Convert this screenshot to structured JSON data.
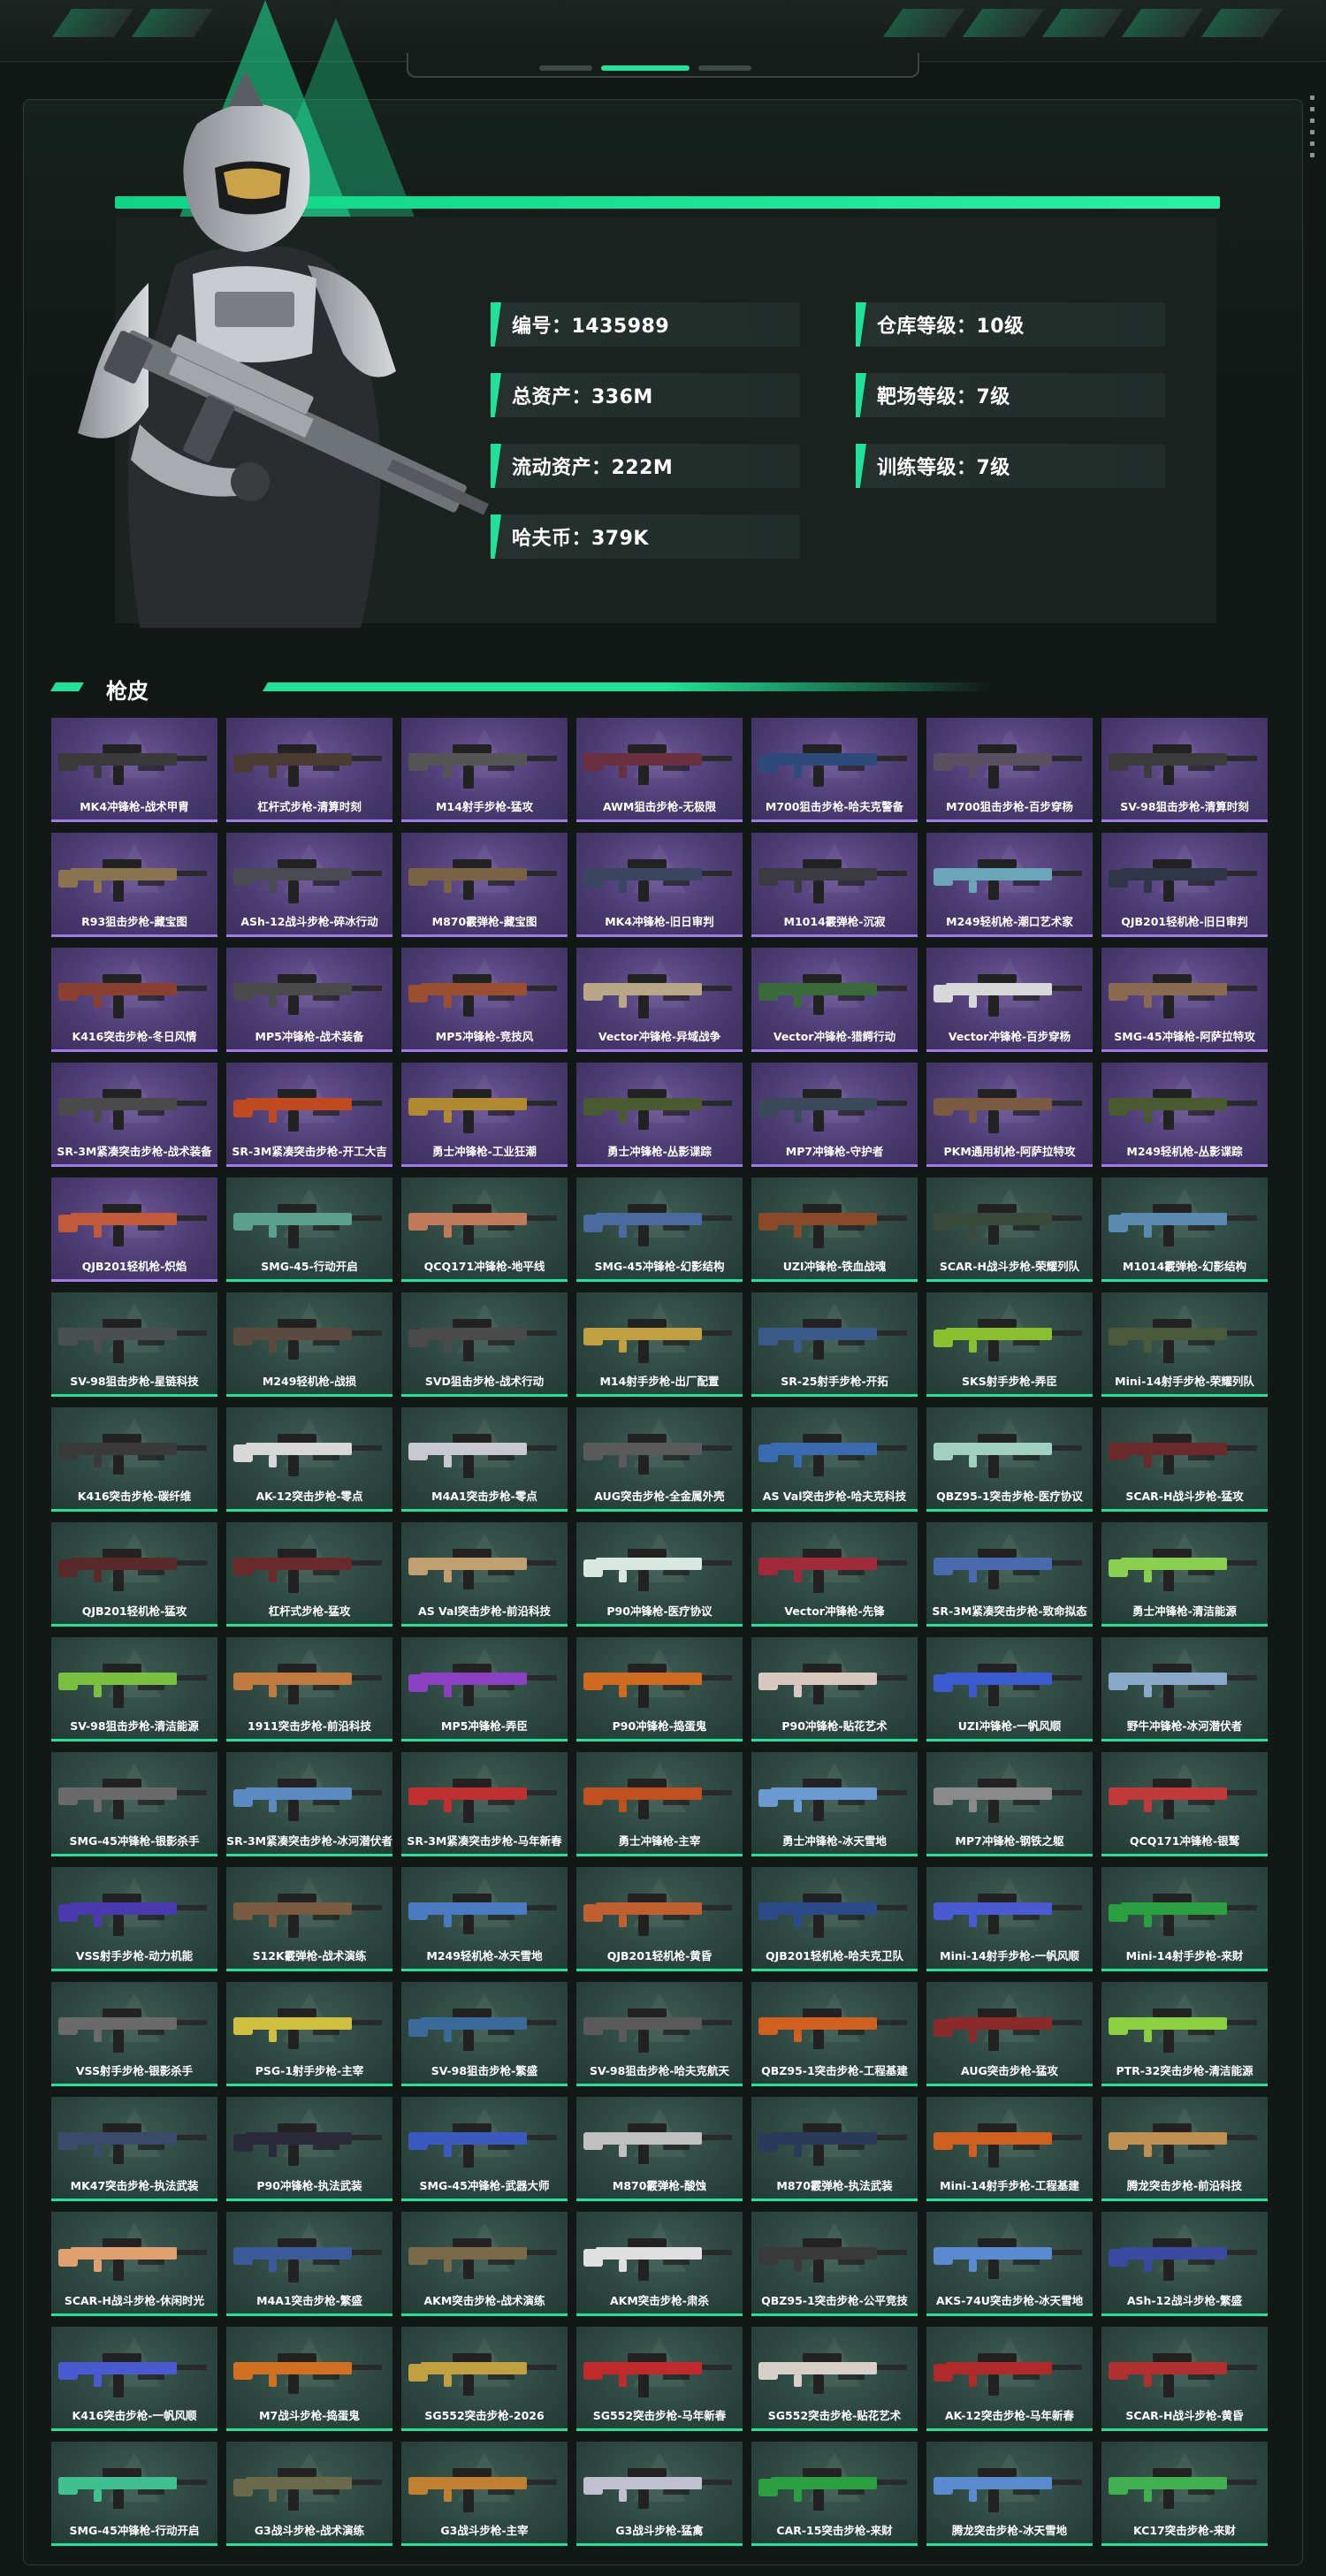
{
  "colors": {
    "accent": "#1fe39a",
    "purple_tier": "#4a3a70",
    "green_tier": "#2c463f"
  },
  "stats": {
    "left": [
      "编号：1435989",
      "总资产：336M",
      "流动资产：222M",
      "哈夫币：379K"
    ],
    "right": [
      "仓库等级：10级",
      "靶场等级：7级",
      "训练等级：7级"
    ]
  },
  "section": {
    "title": "枪皮"
  },
  "skins": [
    {
      "name": "MK4冲锋枪-战术甲胄",
      "tier": "purple",
      "color": "#3a3a3a"
    },
    {
      "name": "杠杆式步枪-清算时刻",
      "tier": "purple",
      "color": "#4a3b33"
    },
    {
      "name": "M14射手步枪-猛攻",
      "tier": "purple",
      "color": "#555555"
    },
    {
      "name": "AWM狙击步枪-无极限",
      "tier": "purple",
      "color": "#6a3040"
    },
    {
      "name": "M700狙击步枪-哈夫克警备",
      "tier": "purple",
      "color": "#2d4a7a"
    },
    {
      "name": "M700狙击步枪-百步穿杨",
      "tier": "purple",
      "color": "#5a5060"
    },
    {
      "name": "SV-98狙击步枪-清算时刻",
      "tier": "purple",
      "color": "#3b3b3b"
    },
    {
      "name": "R93狙击步枪-藏宝图",
      "tier": "purple",
      "color": "#8a7450"
    },
    {
      "name": "ASh-12战斗步枪-碎冰行动",
      "tier": "purple",
      "color": "#4a4a52"
    },
    {
      "name": "M870霰弹枪-藏宝图",
      "tier": "purple",
      "color": "#7a6244"
    },
    {
      "name": "MK4冲锋枪-旧日审判",
      "tier": "purple",
      "color": "#3a4660"
    },
    {
      "name": "M1014霰弹枪-沉寂",
      "tier": "purple",
      "color": "#3a3a40"
    },
    {
      "name": "M249轻机枪-潮口艺术家",
      "tier": "purple",
      "color": "#6aa6b8"
    },
    {
      "name": "QJB201轻机枪-旧日审判",
      "tier": "purple",
      "color": "#2e3648"
    },
    {
      "name": "K416突击步枪-冬日风情",
      "tier": "purple",
      "color": "#8a4030"
    },
    {
      "name": "MP5冲锋枪-战术装备",
      "tier": "purple",
      "color": "#4a4a4a"
    },
    {
      "name": "MP5冲锋枪-竞技风",
      "tier": "purple",
      "color": "#9a5030"
    },
    {
      "name": "Vector冲锋枪-异域战争",
      "tier": "purple",
      "color": "#b8a888"
    },
    {
      "name": "Vector冲锋枪-猎鳄行动",
      "tier": "purple",
      "color": "#3a6a3a"
    },
    {
      "name": "Vector冲锋枪-百步穿杨",
      "tier": "purple",
      "color": "#d8d8d8"
    },
    {
      "name": "SMG-45冲锋枪-阿萨拉特攻",
      "tier": "purple",
      "color": "#8a6a50"
    },
    {
      "name": "SR-3M紧凑突击步枪-战术装备",
      "tier": "purple",
      "color": "#4a4a4a"
    },
    {
      "name": "SR-3M紧凑突击步枪-开工大吉",
      "tier": "purple",
      "color": "#c04a20"
    },
    {
      "name": "勇士冲锋枪-工业狂潮",
      "tier": "purple",
      "color": "#b08a30"
    },
    {
      "name": "勇士冲锋枪-丛影谍踪",
      "tier": "purple",
      "color": "#4a5a30"
    },
    {
      "name": "MP7冲锋枪-守护者",
      "tier": "purple",
      "color": "#3a4a5a"
    },
    {
      "name": "PKM通用机枪-阿萨拉特攻",
      "tier": "purple",
      "color": "#7a5a40"
    },
    {
      "name": "M249轻机枪-丛影谍踪",
      "tier": "purple",
      "color": "#4a5a30"
    },
    {
      "name": "QJB201轻机枪-炽焰",
      "tier": "purple",
      "color": "#c05a3a"
    },
    {
      "name": "SMG-45-行动开启",
      "tier": "green",
      "color": "#5aa08a"
    },
    {
      "name": "QCQ171冲锋枪-地平线",
      "tier": "green",
      "color": "#c07a5a"
    },
    {
      "name": "SMG-45冲锋枪-幻影结构",
      "tier": "green",
      "color": "#4a6aa0"
    },
    {
      "name": "UZI冲锋枪-铁血战魂",
      "tier": "green",
      "color": "#8a4a2a"
    },
    {
      "name": "SCAR-H战斗步枪-荣耀列队",
      "tier": "green",
      "color": "#3a4a3a"
    },
    {
      "name": "M1014霰弹枪-幻影结构",
      "tier": "green",
      "color": "#5a8ab0"
    },
    {
      "name": "SV-98狙击步枪-星链科技",
      "tier": "green",
      "color": "#4a5050"
    },
    {
      "name": "M249轻机枪-战损",
      "tier": "green",
      "color": "#5a4a40"
    },
    {
      "name": "SVD狙击步枪-战术行动",
      "tier": "green",
      "color": "#4a4a4a"
    },
    {
      "name": "M14射手步枪-出厂配置",
      "tier": "green",
      "color": "#c0a040"
    },
    {
      "name": "SR-25射手步枪-开拓",
      "tier": "green",
      "color": "#3a5a8a"
    },
    {
      "name": "SKS射手步枪-弄臣",
      "tier": "green",
      "color": "#8ac030"
    },
    {
      "name": "Mini-14射手步枪-荣耀列队",
      "tier": "green",
      "color": "#4a5a3a"
    },
    {
      "name": "K416突击步枪-碳纤维",
      "tier": "green",
      "color": "#3a3a3a"
    },
    {
      "name": "AK-12突击步枪-零点",
      "tier": "green",
      "color": "#d8d8d8"
    },
    {
      "name": "M4A1突击步枪-零点",
      "tier": "green",
      "color": "#c8c8d0"
    },
    {
      "name": "AUG突击步枪-全金属外壳",
      "tier": "green",
      "color": "#5a5a5a"
    },
    {
      "name": "AS Val突击步枪-哈夫克科技",
      "tier": "green",
      "color": "#3a6ab0"
    },
    {
      "name": "QBZ95-1突击步枪-医疗协议",
      "tier": "green",
      "color": "#a0d0c0"
    },
    {
      "name": "SCAR-H战斗步枪-猛攻",
      "tier": "green",
      "color": "#6a2a2a"
    },
    {
      "name": "QJB201轻机枪-猛攻",
      "tier": "green",
      "color": "#5a2a2a"
    },
    {
      "name": "杠杆式步枪-猛攻",
      "tier": "green",
      "color": "#6a2a2a"
    },
    {
      "name": "AS Val突击步枪-前沿科技",
      "tier": "green",
      "color": "#c0a070"
    },
    {
      "name": "P90冲锋枪-医疗协议",
      "tier": "green",
      "color": "#d8e8e0"
    },
    {
      "name": "Vector冲锋枪-先锋",
      "tier": "green",
      "color": "#a02a3a"
    },
    {
      "name": "SR-3M紧凑突击步枪-致命拟态",
      "tier": "green",
      "color": "#4a6ab0"
    },
    {
      "name": "勇士冲锋枪-清洁能源",
      "tier": "green",
      "color": "#8ad050"
    },
    {
      "name": "SV-98狙击步枪-清洁能源",
      "tier": "green",
      "color": "#7ac040"
    },
    {
      "name": "1911突击步枪-前沿科技",
      "tier": "green",
      "color": "#c07a40"
    },
    {
      "name": "MP5冲锋枪-弄臣",
      "tier": "green",
      "color": "#8a40c0"
    },
    {
      "name": "P90冲锋枪-捣蛋鬼",
      "tier": "green",
      "color": "#d06a20"
    },
    {
      "name": "P90冲锋枪-贴花艺术",
      "tier": "green",
      "color": "#d8c8c0"
    },
    {
      "name": "UZI冲锋枪-一帆风顺",
      "tier": "green",
      "color": "#3a5ad0"
    },
    {
      "name": "野牛冲锋枪-冰河潜伏者",
      "tier": "green",
      "color": "#8aa8c8"
    },
    {
      "name": "SMG-45冲锋枪-银影杀手",
      "tier": "green",
      "color": "#6a6a6a"
    },
    {
      "name": "SR-3M紧凑突击步枪-冰河潜伏者",
      "tier": "green",
      "color": "#5a8ac0"
    },
    {
      "name": "SR-3M紧凑突击步枪-马年新春",
      "tier": "green",
      "color": "#c03030"
    },
    {
      "name": "勇士冲锋枪-主宰",
      "tier": "green",
      "color": "#c05020"
    },
    {
      "name": "勇士冲锋枪-冰天雪地",
      "tier": "green",
      "color": "#6a9ad0"
    },
    {
      "name": "MP7冲锋枪-钢铁之躯",
      "tier": "green",
      "color": "#8a8a8a"
    },
    {
      "name": "QCQ171冲锋枪-银鹫",
      "tier": "green",
      "color": "#c03a3a"
    },
    {
      "name": "VSS射手步枪-动力机能",
      "tier": "green",
      "color": "#4a3ab0"
    },
    {
      "name": "S12K霰弹枪-战术演练",
      "tier": "green",
      "color": "#7a5a40"
    },
    {
      "name": "M249轻机枪-冰天雪地",
      "tier": "green",
      "color": "#4a7ac0"
    },
    {
      "name": "QJB201轻机枪-黄昏",
      "tier": "green",
      "color": "#c06030"
    },
    {
      "name": "QJB201轻机枪-哈夫克卫队",
      "tier": "green",
      "color": "#2a4a8a"
    },
    {
      "name": "Mini-14射手步枪-一帆风顺",
      "tier": "green",
      "color": "#4a5ad0"
    },
    {
      "name": "Mini-14射手步枪-来财",
      "tier": "green",
      "color": "#2aa040"
    },
    {
      "name": "VSS射手步枪-银影杀手",
      "tier": "green",
      "color": "#6a6a6a"
    },
    {
      "name": "PSG-1射手步枪-主宰",
      "tier": "green",
      "color": "#d0c040"
    },
    {
      "name": "SV-98狙击步枪-繁盛",
      "tier": "green",
      "color": "#3a6a9a"
    },
    {
      "name": "SV-98狙击步枪-哈夫克航天",
      "tier": "green",
      "color": "#5a5a5a"
    },
    {
      "name": "QBZ95-1突击步枪-工程基建",
      "tier": "green",
      "color": "#d06020"
    },
    {
      "name": "AUG突击步枪-猛攻",
      "tier": "green",
      "color": "#8a2a2a"
    },
    {
      "name": "PTR-32突击步枪-清洁能源",
      "tier": "green",
      "color": "#8ad040"
    },
    {
      "name": "MK47突击步枪-执法武装",
      "tier": "green",
      "color": "#3a4a6a"
    },
    {
      "name": "P90冲锋枪-执法武装",
      "tier": "green",
      "color": "#2a2a3a"
    },
    {
      "name": "SMG-45冲锋枪-武器大师",
      "tier": "green",
      "color": "#3a5ac0"
    },
    {
      "name": "M870霰弹枪-酸蚀",
      "tier": "green",
      "color": "#c0c0c0"
    },
    {
      "name": "M870霰弹枪-执法武装",
      "tier": "green",
      "color": "#2a3a5a"
    },
    {
      "name": "Mini-14射手步枪-工程基建",
      "tier": "green",
      "color": "#d06020"
    },
    {
      "name": "腾龙突击步枪-前沿科技",
      "tier": "green",
      "color": "#c09050"
    },
    {
      "name": "SCAR-H战斗步枪-休闲时光",
      "tier": "green",
      "color": "#e0a070"
    },
    {
      "name": "M4A1突击步枪-繁盛",
      "tier": "green",
      "color": "#3a5a9a"
    },
    {
      "name": "AKM突击步枪-战术演练",
      "tier": "green",
      "color": "#7a6a4a"
    },
    {
      "name": "AKM突击步枪-肃杀",
      "tier": "green",
      "color": "#e0e0e0"
    },
    {
      "name": "QBZ95-1突击步枪-公平竞技",
      "tier": "green",
      "color": "#3a3a3a"
    },
    {
      "name": "AKS-74U突击步枪-冰天雪地",
      "tier": "green",
      "color": "#5a8ad0"
    },
    {
      "name": "ASh-12战斗步枪-繁盛",
      "tier": "green",
      "color": "#3a4aa0"
    },
    {
      "name": "K416突击步枪-一帆风顺",
      "tier": "green",
      "color": "#4a5ad0"
    },
    {
      "name": "M7战斗步枪-捣蛋鬼",
      "tier": "green",
      "color": "#d07020"
    },
    {
      "name": "SG552突击步枪-2026",
      "tier": "green",
      "color": "#c0a040"
    },
    {
      "name": "SG552突击步枪-马年新春",
      "tier": "green",
      "color": "#c02a2a"
    },
    {
      "name": "SG552突击步枪-贴花艺术",
      "tier": "green",
      "color": "#d8d0c8"
    },
    {
      "name": "AK-12突击步枪-马年新春",
      "tier": "green",
      "color": "#b02a2a"
    },
    {
      "name": "SCAR-H战斗步枪-黄昏",
      "tier": "green",
      "color": "#b03030"
    },
    {
      "name": "SMG-45冲锋枪-行动开启",
      "tier": "green",
      "color": "#40c090"
    },
    {
      "name": "G3战斗步枪-战术演练",
      "tier": "green",
      "color": "#6a6a4a"
    },
    {
      "name": "G3战斗步枪-主宰",
      "tier": "green",
      "color": "#c08030"
    },
    {
      "name": "G3战斗步枪-猛禽",
      "tier": "green",
      "color": "#c0c0d0"
    },
    {
      "name": "CAR-15突击步枪-来财",
      "tier": "green",
      "color": "#2aa040"
    },
    {
      "name": "腾龙突击步枪-冰天雪地",
      "tier": "green",
      "color": "#5a8ad0"
    },
    {
      "name": "KC17突击步枪-来财",
      "tier": "green",
      "color": "#40b050"
    }
  ]
}
